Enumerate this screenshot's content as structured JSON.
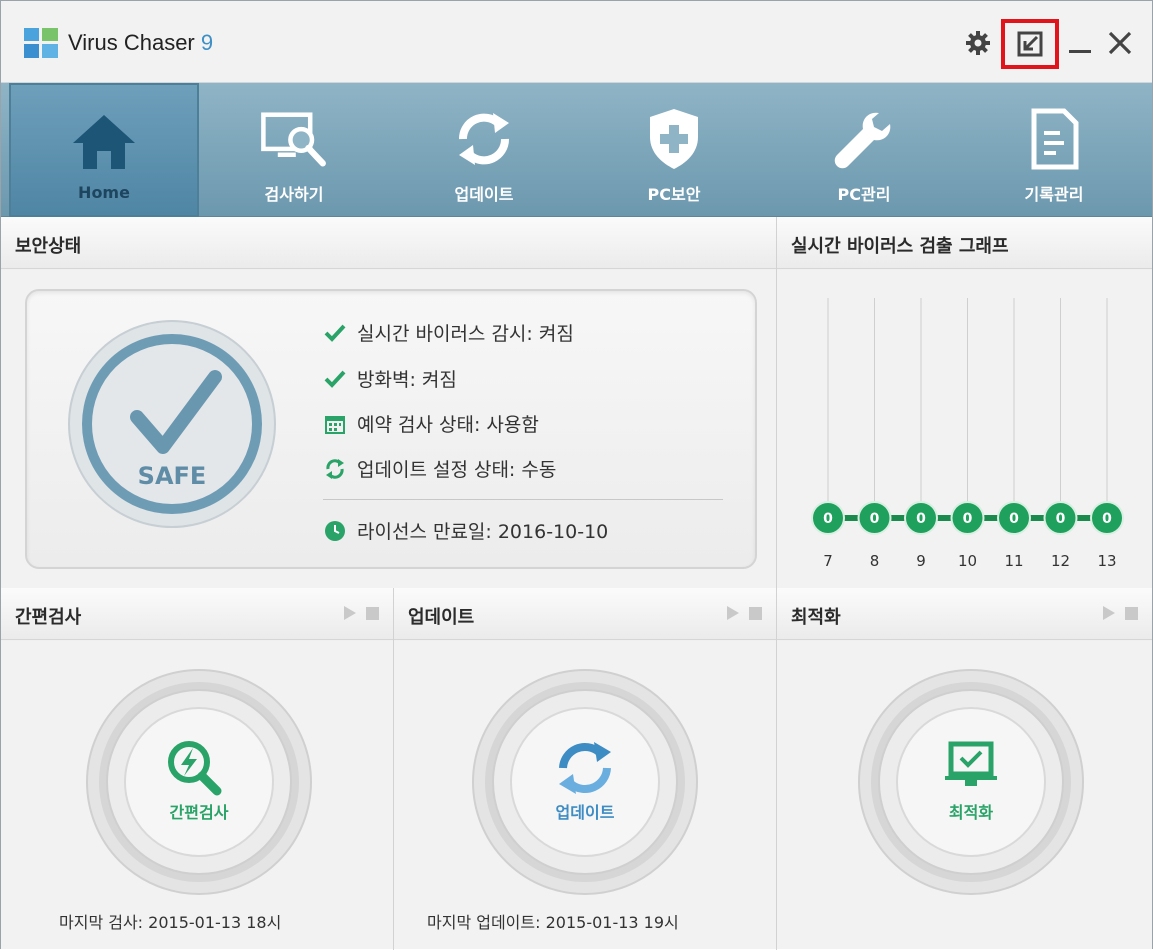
{
  "window": {
    "title_main": "Virus Chaser",
    "title_version": "9",
    "icons": [
      "gear-icon",
      "mini-mode-icon",
      "minimize-icon",
      "close-icon"
    ]
  },
  "nav": [
    {
      "label": "Home",
      "icon": "home-icon",
      "active": true
    },
    {
      "label": "검사하기",
      "icon": "monitor-search-icon",
      "active": false
    },
    {
      "label": "업데이트",
      "icon": "refresh-icon",
      "active": false
    },
    {
      "label": "PC보안",
      "icon": "shield-plus-icon",
      "active": false
    },
    {
      "label": "PC관리",
      "icon": "wrench-icon",
      "active": false
    },
    {
      "label": "기록관리",
      "icon": "document-icon",
      "active": false
    }
  ],
  "security": {
    "header": "보안상태",
    "safe_label": "SAFE",
    "items": [
      {
        "icon": "check-icon",
        "text": "실시간 바이러스 감시: 켜짐"
      },
      {
        "icon": "check-icon",
        "text": "방화벽: 켜짐"
      },
      {
        "icon": "calendar-icon",
        "text": "예약 검사 상태: 사용함"
      },
      {
        "icon": "refresh-icon",
        "text": "업데이트 설정 상태: 수동"
      }
    ],
    "license": {
      "icon": "clock-icon",
      "text": "라이선스 만료일: 2016-10-10"
    }
  },
  "graph": {
    "header": "실시간 바이러스 검출 그래프",
    "colors": {
      "node": "#1fa05c",
      "line": "#1a8a4d"
    }
  },
  "chart_data": {
    "type": "line",
    "categories": [
      "7",
      "8",
      "9",
      "10",
      "11",
      "12",
      "13"
    ],
    "series": [
      {
        "values": [
          0,
          0,
          0,
          0,
          0,
          0,
          0
        ]
      }
    ]
  },
  "quick_scan": {
    "header": "간편검사",
    "button_label": "간편검사",
    "footer": "마지막 검사: 2015-01-13 18시"
  },
  "update": {
    "header": "업데이트",
    "button_label": "업데이트",
    "footer": "마지막 업데이트: 2015-01-13 19시"
  },
  "optimize": {
    "header": "최적화",
    "button_label": "최적화"
  },
  "colors": {
    "accent_green": "#2aa368",
    "accent_blue": "#3d8cc3",
    "highlight_red": "#e2141b"
  }
}
